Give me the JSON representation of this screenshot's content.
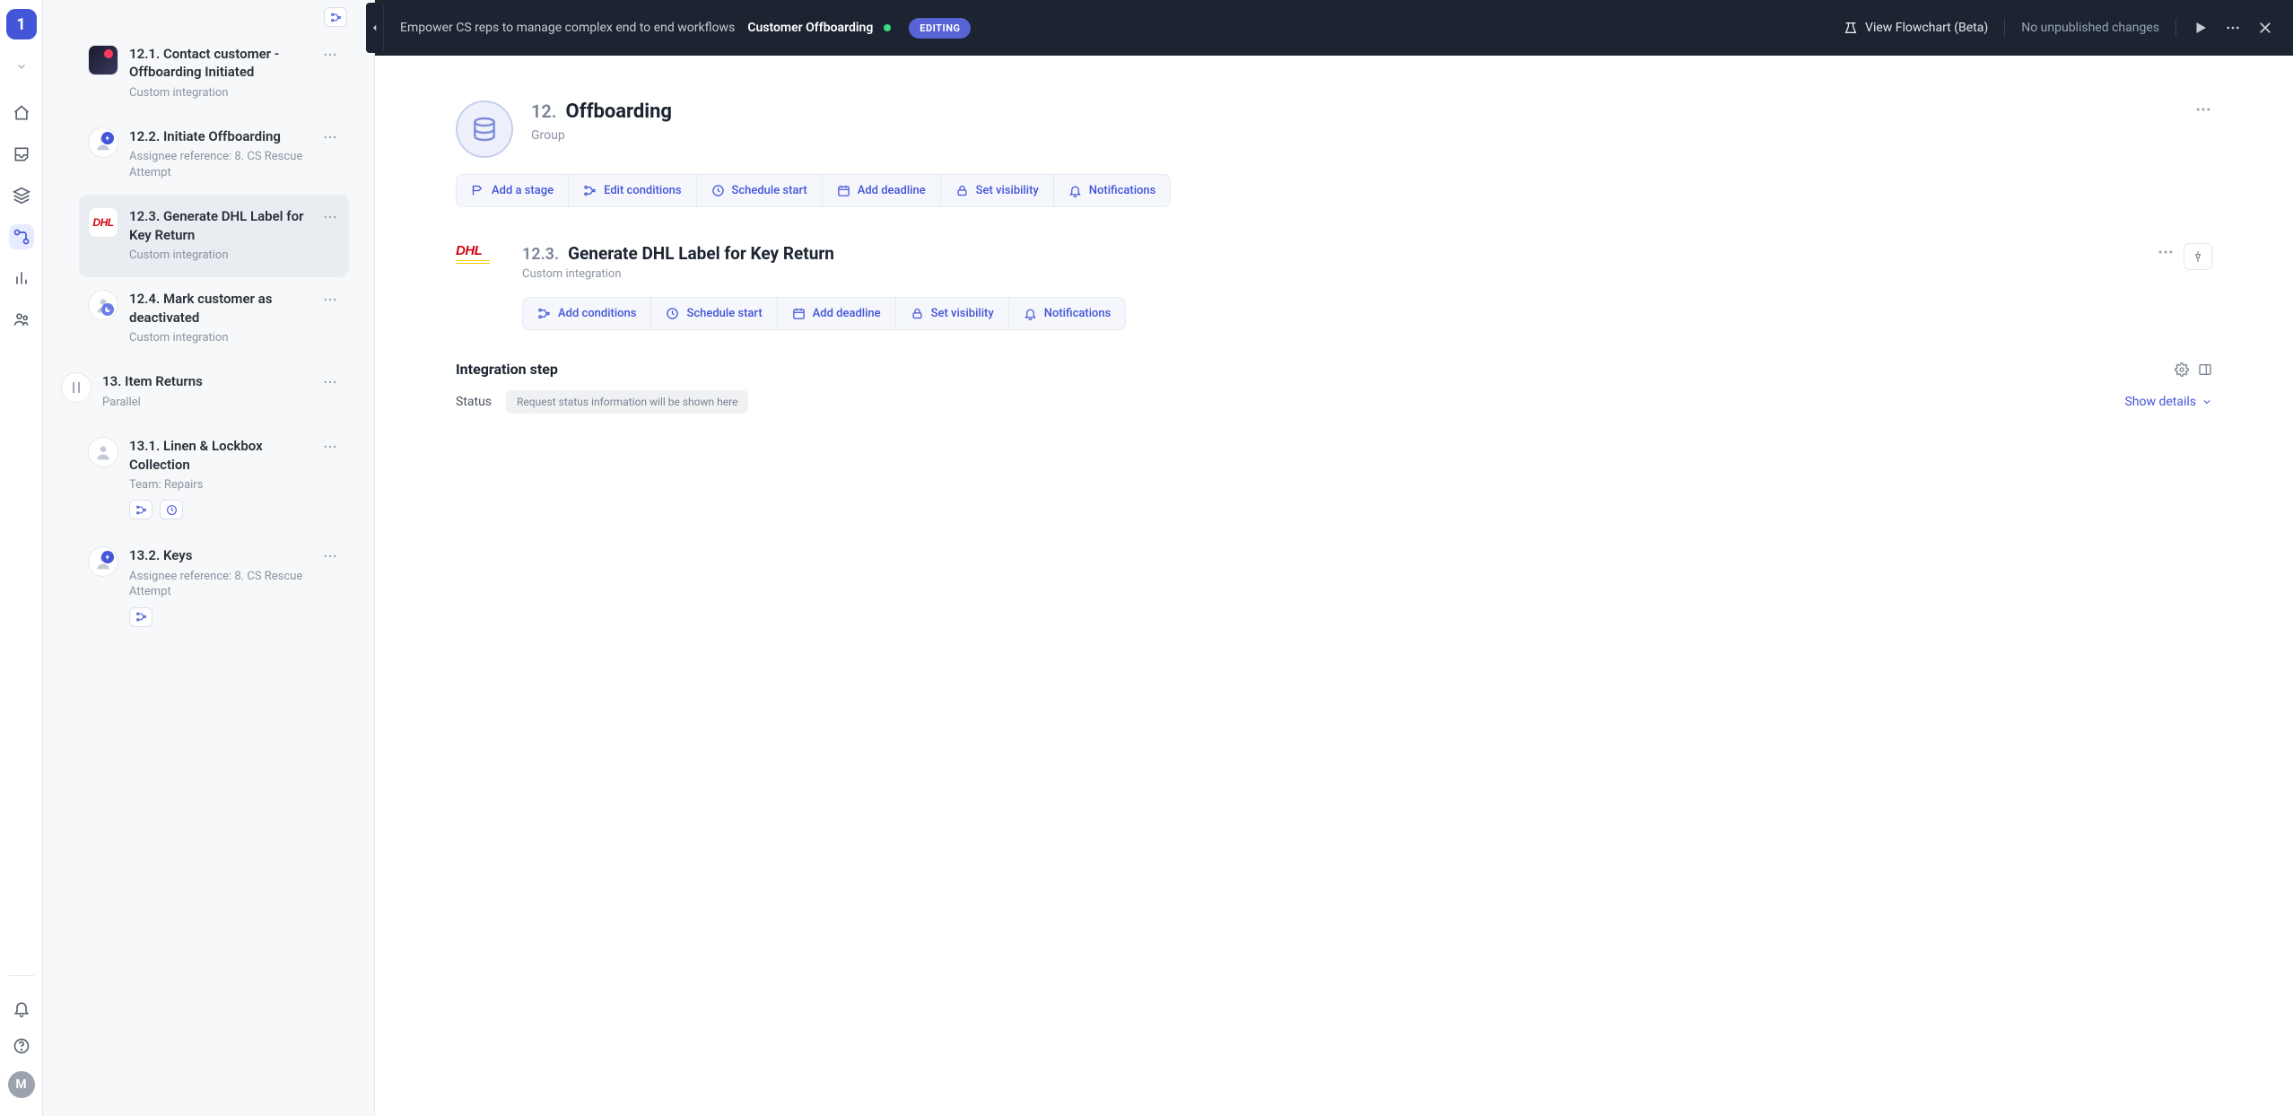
{
  "rail": {
    "logo_text": "1",
    "avatar_text": "M"
  },
  "topbar": {
    "crumb_prefix": "Empower CS reps to manage complex end to end workflows",
    "crumb_current": "Customer Offboarding",
    "pill": "EDITING",
    "flowchart": "View Flowchart (Beta)",
    "publish_state": "No unpublished changes"
  },
  "sidebar": {
    "items": [
      {
        "title": "12.1. Contact customer - Offboarding Initiated",
        "subtitle": "Custom integration",
        "icon": "integration",
        "indent": true,
        "chips": [
          "conditions"
        ]
      },
      {
        "title": "12.2. Initiate Offboarding",
        "subtitle": "Assignee reference: 8. CS Rescue Attempt",
        "icon": "person-bolt",
        "indent": true
      },
      {
        "title": "12.3. Generate DHL Label for Key Return",
        "subtitle": "Custom integration",
        "icon": "dhl",
        "indent": true,
        "active": true
      },
      {
        "title": "12.4. Mark customer as deactivated",
        "subtitle": "Custom integration",
        "icon": "person-moon",
        "indent": true
      },
      {
        "title": "13. Item Returns",
        "subtitle": "Parallel",
        "icon": "parallel",
        "indent": false
      },
      {
        "title": "13.1. Linen & Lockbox Collection",
        "subtitle": "Team: Repairs",
        "icon": "person",
        "indent": true,
        "chips": [
          "conditions",
          "time"
        ]
      },
      {
        "title": "13.2. Keys",
        "subtitle": "Assignee reference: 8. CS Rescue Attempt",
        "icon": "person-bolt",
        "indent": true,
        "chips": [
          "conditions"
        ]
      }
    ]
  },
  "group": {
    "number": "12.",
    "name": "Offboarding",
    "type": "Group",
    "actions": {
      "add_stage": "Add a stage",
      "edit_conditions": "Edit conditions",
      "schedule_start": "Schedule start",
      "add_deadline": "Add deadline",
      "set_visibility": "Set visibility",
      "notifications": "Notifications"
    }
  },
  "detail": {
    "number": "12.3.",
    "name": "Generate DHL Label for Key Return",
    "type": "Custom integration",
    "actions": {
      "add_conditions": "Add conditions",
      "schedule_start": "Schedule start",
      "add_deadline": "Add deadline",
      "set_visibility": "Set visibility",
      "notifications": "Notifications"
    },
    "section_title": "Integration step",
    "status_label": "Status",
    "status_text": "Request status information will be shown here",
    "show_details": "Show details"
  }
}
